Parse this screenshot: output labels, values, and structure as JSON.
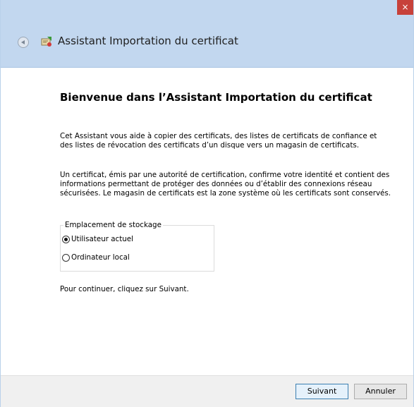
{
  "window": {
    "title": "Assistant Importation du certificat",
    "close_glyph": "×",
    "back_icon": "back-arrow-icon",
    "app_icon": "certificate-wizard-icon"
  },
  "main": {
    "heading": "Bienvenue dans l’Assistant Importation du certificat",
    "paragraph1": "Cet Assistant vous aide à copier des certificats, des listes de certificats de confiance et des listes de révocation des certificats d’un disque vers un magasin de certificats.",
    "paragraph2": "Un certificat, émis par une autorité de certification, confirme votre identité et contient des informations permettant de protéger des données ou d’établir des connexions réseau sécurisées. Le magasin de certificats est la zone système où les certificats sont conservés.",
    "storage": {
      "legend": "Emplacement de stockage",
      "options": [
        {
          "label": "Utilisateur actuel",
          "checked": true
        },
        {
          "label": "Ordinateur local",
          "checked": false
        }
      ]
    },
    "continue_text": "Pour continuer, cliquez sur Suivant."
  },
  "footer": {
    "next_label": "Suivant",
    "cancel_label": "Annuler"
  }
}
